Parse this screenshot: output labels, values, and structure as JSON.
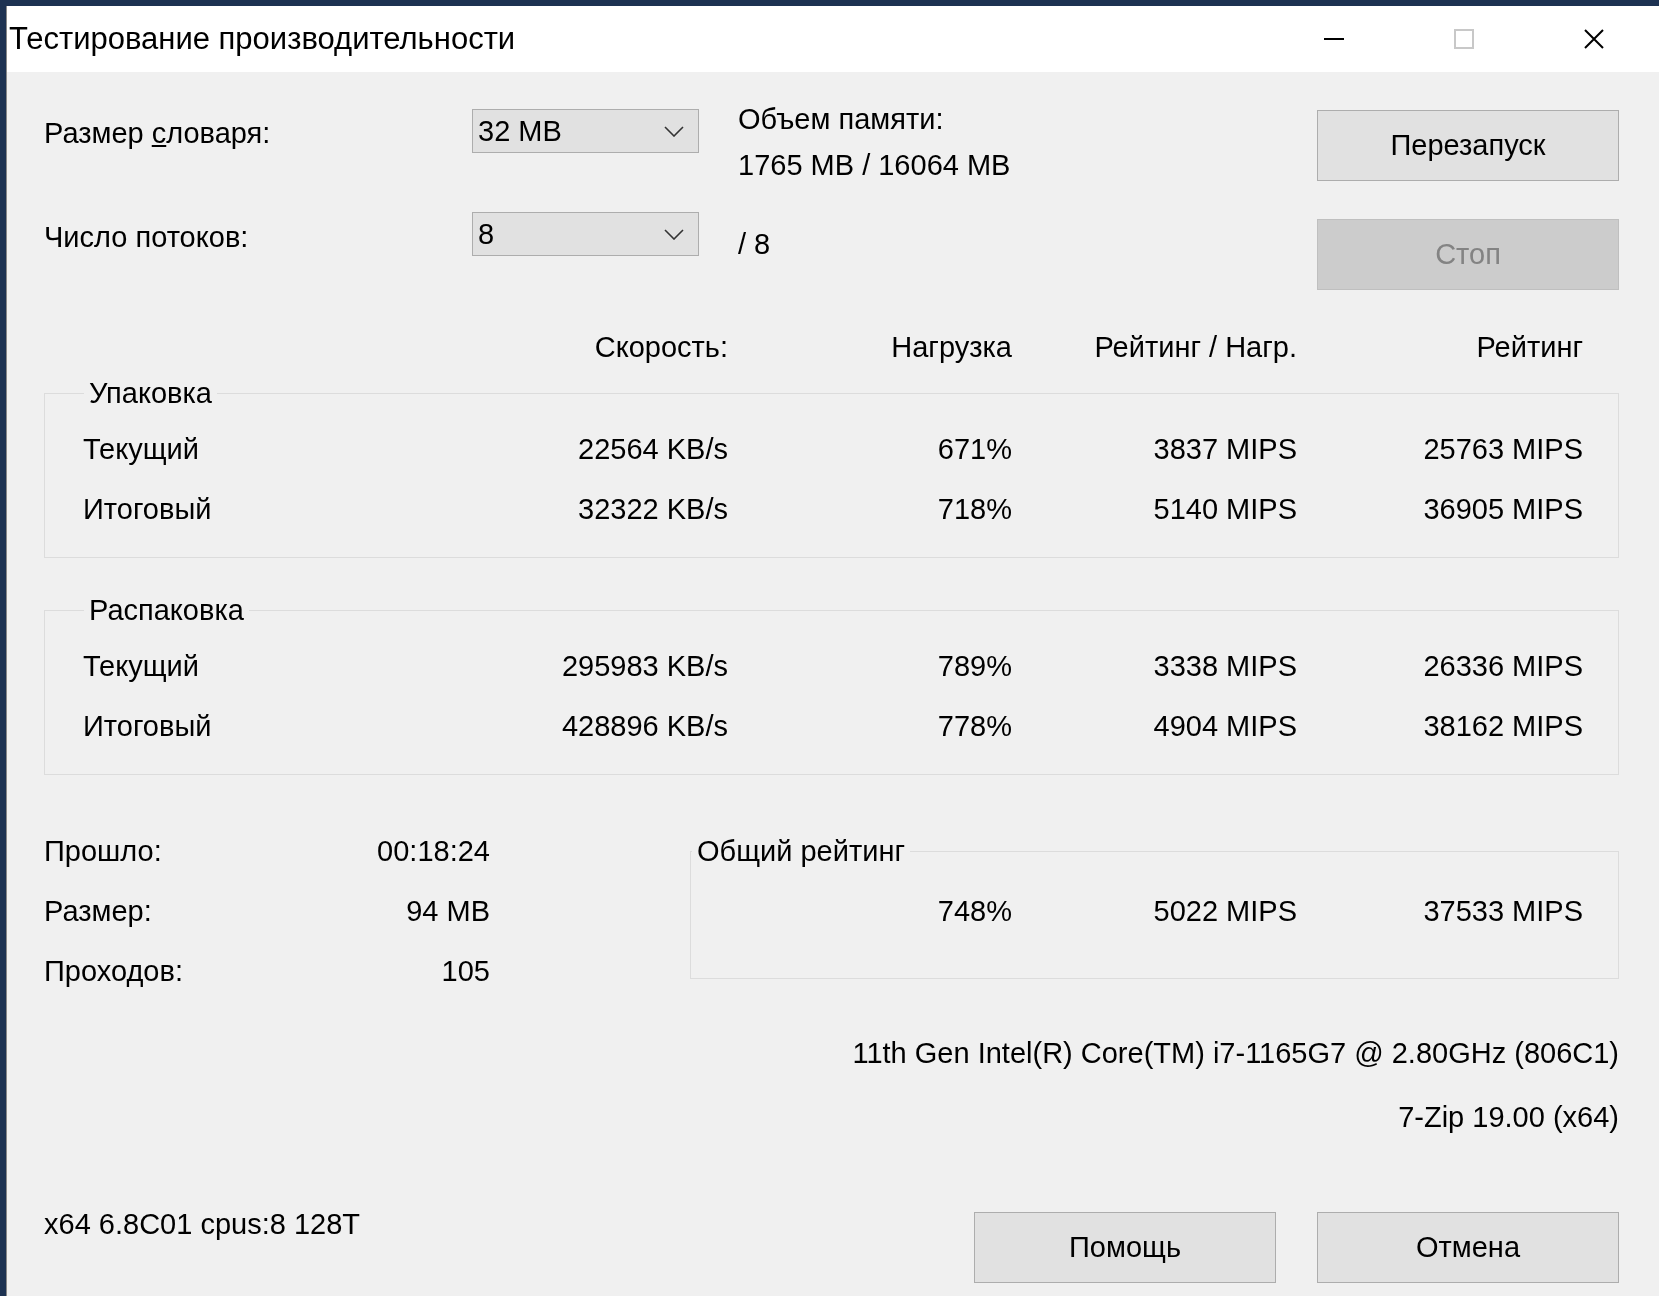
{
  "window": {
    "title": "Тестирование производительности",
    "controls": [
      {
        "kind": "minimize",
        "disabled": false
      },
      {
        "kind": "maximize",
        "disabled": true
      },
      {
        "kind": "close",
        "disabled": false
      }
    ]
  },
  "dictionary": {
    "label_parts": [
      "Размер ",
      "с",
      "ловаря:"
    ],
    "value": "32 MB"
  },
  "memory": {
    "label": "Объем памяти:",
    "value": "1765 MB / 16064 MB"
  },
  "threads": {
    "label": "Число потоков:",
    "value": "8",
    "max": "/ 8"
  },
  "side_buttons": [
    {
      "label": "Перезапуск",
      "disabled": false
    },
    {
      "label": "Стоп",
      "disabled": true
    }
  ],
  "columns": [
    "Скорость:",
    "Нагрузка",
    "Рейтинг / Нагр.",
    "Рейтинг"
  ],
  "groups": [
    {
      "title": "Упаковка",
      "rows": [
        {
          "label": "Текущий",
          "values": [
            "22564 KB/s",
            "671%",
            "3837 MIPS",
            "25763 MIPS"
          ]
        },
        {
          "label": "Итоговый",
          "values": [
            "32322 KB/s",
            "718%",
            "5140 MIPS",
            "36905 MIPS"
          ]
        }
      ]
    },
    {
      "title": "Распаковка",
      "rows": [
        {
          "label": "Текущий",
          "values": [
            "295983 KB/s",
            "789%",
            "3338 MIPS",
            "26336 MIPS"
          ]
        },
        {
          "label": "Итоговый",
          "values": [
            "428896 KB/s",
            "778%",
            "4904 MIPS",
            "38162 MIPS"
          ]
        }
      ]
    }
  ],
  "stats": [
    {
      "label": "Прошло:",
      "value": "00:18:24"
    },
    {
      "label": "Размер:",
      "value": "94 MB"
    },
    {
      "label": "Проходов:",
      "value": "105"
    }
  ],
  "total": {
    "title": "Общий рейтинг",
    "values": [
      "748%",
      "5022 MIPS",
      "37533 MIPS"
    ]
  },
  "cpu": "11th Gen Intel(R) Core(TM) i7-1165G7 @ 2.80GHz (806C1)",
  "version": "7-Zip 19.00 (x64)",
  "footer": "x64 6.8C01 cpus:8 128T",
  "bottom_buttons": [
    {
      "label": "Помощь",
      "disabled": false
    },
    {
      "label": "Отмена",
      "disabled": false
    }
  ]
}
